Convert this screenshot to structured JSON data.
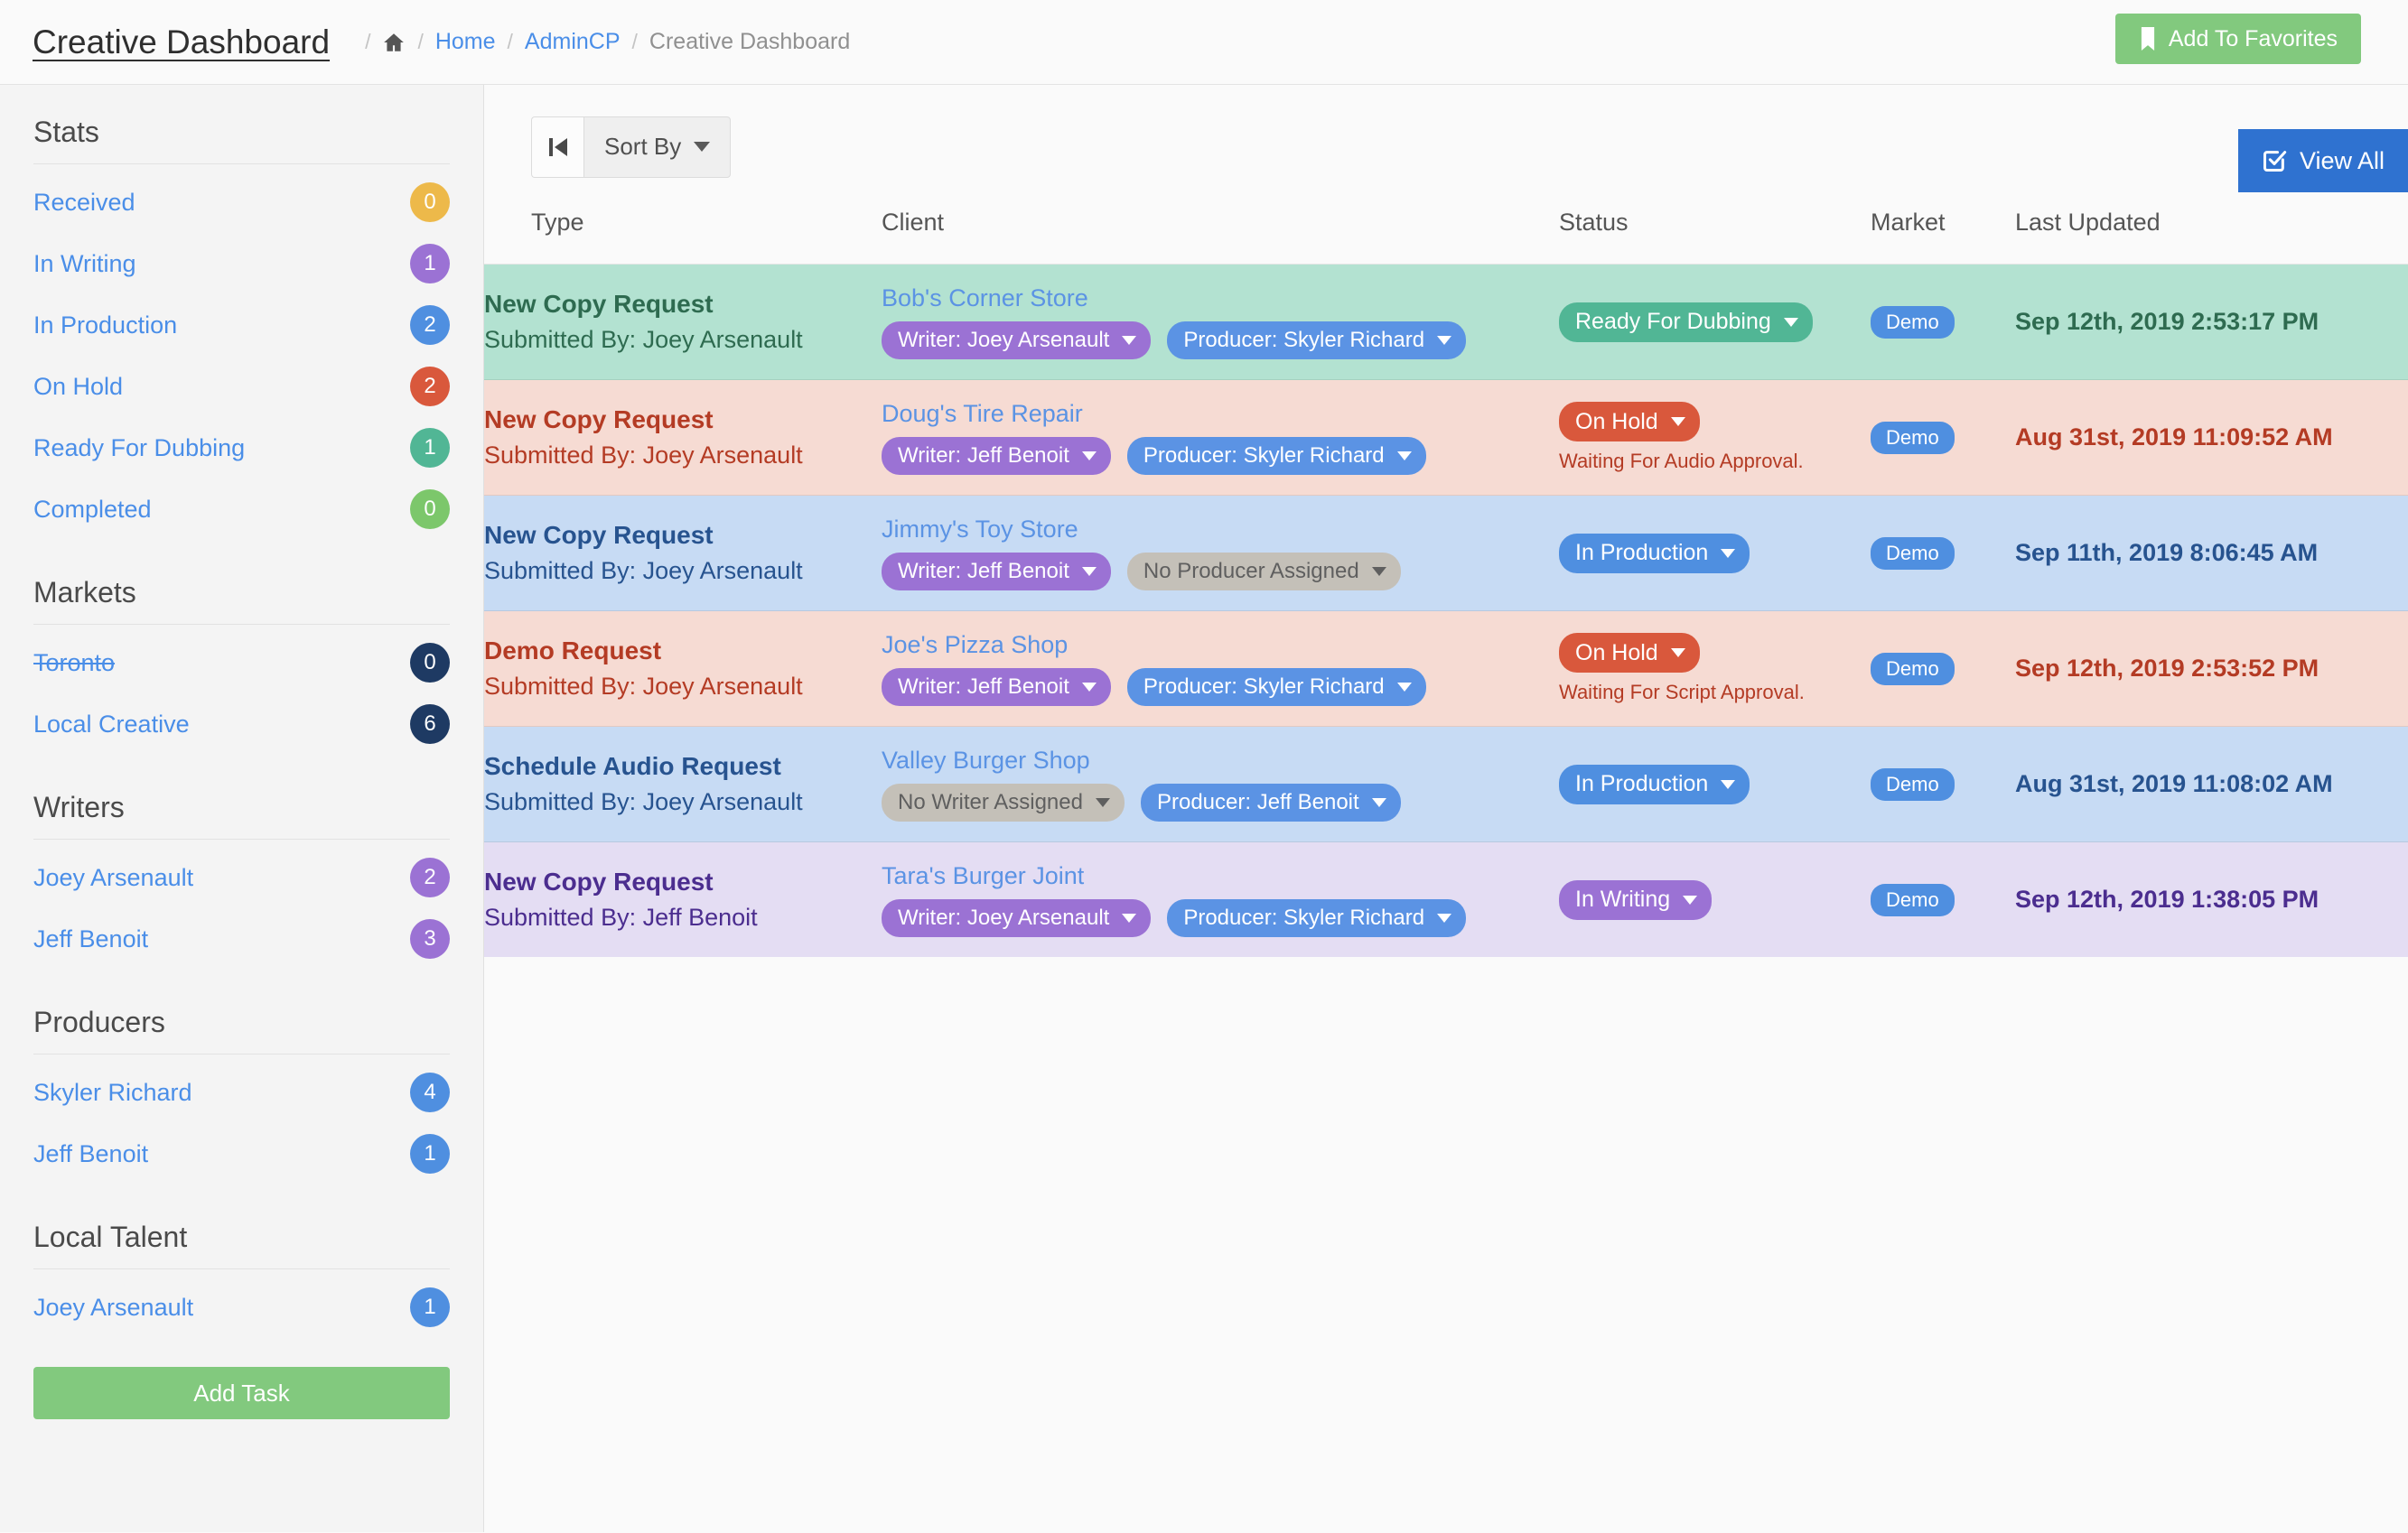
{
  "header": {
    "title": "Creative Dashboard",
    "breadcrumb": {
      "home_icon": "home-icon",
      "items": [
        "Home",
        "AdminCP"
      ],
      "current": "Creative Dashboard",
      "separator": "/"
    },
    "favorites_button": {
      "label": "Add To Favorites",
      "icon": "bookmark-icon",
      "color": "#82c97e"
    }
  },
  "sidebar": {
    "sections": [
      {
        "title": "Stats",
        "items": [
          {
            "label": "Received",
            "count": "0",
            "color": "#edb94a",
            "struck": false
          },
          {
            "label": "In Writing",
            "count": "1",
            "color": "#9b72d4",
            "struck": false
          },
          {
            "label": "In Production",
            "count": "2",
            "color": "#4f8fe0",
            "struck": false
          },
          {
            "label": "On Hold",
            "count": "2",
            "color": "#d9583c",
            "struck": false
          },
          {
            "label": "Ready For Dubbing",
            "count": "1",
            "color": "#51b695",
            "struck": false
          },
          {
            "label": "Completed",
            "count": "0",
            "color": "#7cc76b",
            "struck": false
          }
        ]
      },
      {
        "title": "Markets",
        "items": [
          {
            "label": "Toronto",
            "count": "0",
            "color": "#1e3a63",
            "struck": true
          },
          {
            "label": "Local Creative",
            "count": "6",
            "color": "#1e3a63",
            "struck": false
          }
        ]
      },
      {
        "title": "Writers",
        "items": [
          {
            "label": "Joey Arsenault",
            "count": "2",
            "color": "#9b72d4",
            "struck": false
          },
          {
            "label": "Jeff Benoit",
            "count": "3",
            "color": "#9b72d4",
            "struck": false
          }
        ]
      },
      {
        "title": "Producers",
        "items": [
          {
            "label": "Skyler Richard",
            "count": "4",
            "color": "#4f8fe0",
            "struck": false
          },
          {
            "label": "Jeff Benoit",
            "count": "1",
            "color": "#4f8fe0",
            "struck": false
          }
        ]
      },
      {
        "title": "Local Talent",
        "items": [
          {
            "label": "Joey Arsenault",
            "count": "1",
            "color": "#4f8fe0",
            "struck": false
          }
        ]
      }
    ],
    "add_task_button": {
      "label": "Add Task",
      "color": "#82c97e"
    }
  },
  "toolbar": {
    "first_page_icon": "step-backward-icon",
    "sort_by_label": "Sort By",
    "sort_by_caret": "caret-down-icon",
    "view_all_label": "View All",
    "view_all_icon": "check-square-icon",
    "view_all_color": "#2f72d0"
  },
  "table": {
    "columns": [
      "Type",
      "Client",
      "Status",
      "Market",
      "Last Updated"
    ],
    "rows": [
      {
        "theme": "green",
        "type": "New Copy Request",
        "submitted_by": "Submitted By: Joey Arsenault",
        "client": "Bob's Corner Store",
        "writer_pill": {
          "label": "Writer: Joey Arsenault",
          "kind": "writer"
        },
        "producer_pill": {
          "label": "Producer: Skyler Richard",
          "kind": "producer"
        },
        "status": {
          "label": "Ready For Dubbing",
          "class": "st-ready"
        },
        "status_note": "",
        "market": "Demo",
        "last_updated": "Sep 12th, 2019 2:53:17 PM"
      },
      {
        "theme": "red",
        "type": "New Copy Request",
        "submitted_by": "Submitted By: Joey Arsenault",
        "client": "Doug's Tire Repair",
        "writer_pill": {
          "label": "Writer: Jeff Benoit",
          "kind": "writer"
        },
        "producer_pill": {
          "label": "Producer: Skyler Richard",
          "kind": "producer"
        },
        "status": {
          "label": "On Hold",
          "class": "st-hold"
        },
        "status_note": "Waiting For Audio Approval.",
        "market": "Demo",
        "last_updated": "Aug 31st, 2019 11:09:52 AM"
      },
      {
        "theme": "blue",
        "type": "New Copy Request",
        "submitted_by": "Submitted By: Joey Arsenault",
        "client": "Jimmy's Toy Store",
        "writer_pill": {
          "label": "Writer: Jeff Benoit",
          "kind": "writer"
        },
        "producer_pill": {
          "label": "No Producer Assigned",
          "kind": "none"
        },
        "status": {
          "label": "In Production",
          "class": "st-prod"
        },
        "status_note": "",
        "market": "Demo",
        "last_updated": "Sep 11th, 2019 8:06:45 AM"
      },
      {
        "theme": "red",
        "type": "Demo Request",
        "submitted_by": "Submitted By: Joey Arsenault",
        "client": "Joe's Pizza Shop",
        "writer_pill": {
          "label": "Writer: Jeff Benoit",
          "kind": "writer"
        },
        "producer_pill": {
          "label": "Producer: Skyler Richard",
          "kind": "producer"
        },
        "status": {
          "label": "On Hold",
          "class": "st-hold"
        },
        "status_note": "Waiting For Script Approval.",
        "market": "Demo",
        "last_updated": "Sep 12th, 2019 2:53:52 PM"
      },
      {
        "theme": "blue",
        "type": "Schedule Audio Request",
        "submitted_by": "Submitted By: Joey Arsenault",
        "client": "Valley Burger Shop",
        "writer_pill": {
          "label": "No Writer Assigned",
          "kind": "none"
        },
        "producer_pill": {
          "label": "Producer: Jeff Benoit",
          "kind": "producer"
        },
        "status": {
          "label": "In Production",
          "class": "st-prod"
        },
        "status_note": "",
        "market": "Demo",
        "last_updated": "Aug 31st, 2019 11:08:02 AM"
      },
      {
        "theme": "purple",
        "type": "New Copy Request",
        "submitted_by": "Submitted By: Jeff Benoit",
        "client": "Tara's Burger Joint",
        "writer_pill": {
          "label": "Writer: Joey Arsenault",
          "kind": "writer"
        },
        "producer_pill": {
          "label": "Producer: Skyler Richard",
          "kind": "producer"
        },
        "status": {
          "label": "In Writing",
          "class": "st-writing"
        },
        "status_note": "",
        "market": "Demo",
        "last_updated": "Sep 12th, 2019 1:38:05 PM"
      }
    ]
  }
}
